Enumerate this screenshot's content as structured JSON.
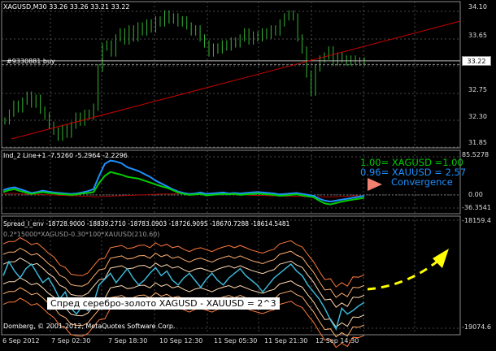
{
  "colors": {
    "background": "#000000",
    "grid": "#4a4a4a",
    "price_line": "#ffffff",
    "candles": "#35b535",
    "trendline": "#cc0000",
    "ind_green": "#00cc00",
    "ind_blue": "#1e90ff",
    "ind_red": "#aa0000",
    "spread_cyan": "#3ab6d8",
    "band_colors": [
      "#ffd9b0",
      "#ffb070",
      "#ff7a3c"
    ],
    "arrow_yellow": "#ffff00",
    "convergence_arrow": "#f08070"
  },
  "main_panel": {
    "header": "XAGUSD,M30  33.26 33.26 33.21 33.22",
    "order_label": "#9330881 buy",
    "current_price": "33.22",
    "y_ticks": [
      "34.10",
      "33.65",
      "33.22",
      "32.75",
      "32.30",
      "31.85"
    ]
  },
  "indicator_panel": {
    "header": "Ind_2 Line+1 -7.5260 -5.2964 -2.2296",
    "y_ticks": [
      "85.5278",
      "0.00",
      "-36.3541"
    ],
    "legend": [
      {
        "text": "1.00= XAGUSD =1.00",
        "color": "#00cc00"
      },
      {
        "text": "0.96= XAUUSD = 2.57",
        "color": "#1e90ff"
      },
      {
        "text": "Convergence",
        "color": "#1e90ff"
      }
    ]
  },
  "spread_panel": {
    "header": "Spread_I_env -18728.9000 -18839.2710 -18783.0903 -18726.9095 -18670.7288 -18614.5481",
    "formula": "0.2*15000*XAGUSD-0.30*100*XAUUSD(210.60)",
    "y_ticks": [
      "-18159.4",
      "-19074.6"
    ],
    "annotation": "Спред серебро-золото XAGUSD - XAUUSD = 2^3",
    "copyright": "Domberg, © 2001-2012, MetaQuotes Software Corp."
  },
  "time_axis": [
    "6 Sep 2012",
    "7 Sep 02:30",
    "7 Sep 18:30",
    "10 Sep 12:30",
    "11 Sep 05:30",
    "11 Sep 21:30",
    "12 Sep 14:30"
  ],
  "series": {
    "price": [
      32.22,
      32.35,
      32.5,
      32.42,
      32.55,
      32.65,
      32.5,
      32.6,
      32.4,
      32.3,
      32.15,
      32.05,
      31.95,
      32.1,
      32.0,
      32.15,
      32.3,
      32.2,
      32.35,
      32.3,
      32.45,
      33.1,
      33.45,
      33.5,
      33.35,
      33.6,
      33.7,
      33.55,
      33.75,
      33.6,
      33.8,
      33.7,
      33.85,
      33.75,
      33.9,
      33.85,
      34.0,
      33.9,
      33.95,
      33.85,
      33.9,
      33.8,
      33.7,
      33.75,
      33.6,
      33.5,
      33.35,
      33.45,
      33.4,
      33.5,
      33.45,
      33.55,
      33.5,
      33.6,
      33.7,
      33.55,
      33.65,
      33.6,
      33.7,
      33.65,
      33.75,
      33.7,
      33.85,
      33.95,
      34.0,
      33.95,
      33.6,
      33.4,
      33.0,
      32.7,
      33.1,
      33.25,
      33.3,
      33.4,
      33.2,
      33.3,
      33.25,
      33.2,
      33.25,
      33.22,
      33.2,
      33.22
    ],
    "ind_green": [
      6,
      10,
      12,
      8,
      5,
      2,
      4,
      6,
      4,
      3,
      2,
      1,
      0,
      1,
      3,
      4,
      6,
      25,
      40,
      48,
      45,
      42,
      38,
      36,
      34,
      30,
      26,
      22,
      18,
      15,
      10,
      5,
      2,
      0,
      1,
      2,
      -1,
      0,
      1,
      2,
      1,
      2,
      0,
      1,
      2,
      3,
      2,
      1,
      0,
      -2,
      -1,
      0,
      1,
      -1,
      -3,
      -5,
      -12,
      -18,
      -20,
      -17,
      -14,
      -12,
      -10,
      -8,
      -6
    ],
    "ind_blue": [
      10,
      14,
      16,
      12,
      8,
      4,
      6,
      9,
      7,
      5,
      4,
      3,
      2,
      3,
      5,
      8,
      12,
      40,
      65,
      72,
      70,
      66,
      58,
      54,
      50,
      44,
      38,
      30,
      24,
      18,
      12,
      7,
      4,
      2,
      3,
      5,
      2,
      3,
      4,
      5,
      3,
      4,
      3,
      4,
      5,
      6,
      5,
      4,
      3,
      1,
      2,
      3,
      4,
      2,
      0,
      -2,
      -8,
      -12,
      -14,
      -12,
      -10,
      -8,
      -6,
      -4,
      -2
    ],
    "ind_red": [
      2,
      3,
      3,
      2,
      2,
      1,
      1,
      1,
      0,
      0,
      -1,
      -1,
      -2,
      -2,
      -3,
      -3,
      -4,
      -4,
      -3,
      -3,
      -2,
      -2,
      -1,
      -1,
      0,
      0,
      1,
      1,
      2,
      2,
      2,
      3,
      3,
      3,
      3,
      3,
      2,
      2,
      2,
      1,
      1,
      1,
      0,
      0,
      -1,
      -1,
      -1,
      -2,
      -2,
      -2,
      -3,
      -3,
      -3,
      -3,
      -4,
      -4,
      -4,
      -4,
      -4,
      -4,
      -3,
      -3,
      -2,
      -2,
      -2
    ],
    "spread": [
      -18620,
      -18500,
      -18580,
      -18640,
      -18560,
      -18520,
      -18600,
      -18680,
      -18640,
      -18720,
      -18820,
      -18760,
      -18900,
      -18950,
      -18880,
      -18920,
      -18860,
      -18700,
      -18650,
      -18600,
      -18680,
      -18620,
      -18560,
      -18640,
      -18700,
      -18660,
      -18600,
      -18550,
      -18620,
      -18580,
      -18660,
      -18700,
      -18640,
      -18600,
      -18660,
      -18720,
      -18650,
      -18600,
      -18660,
      -18700,
      -18640,
      -18600,
      -18560,
      -18620,
      -18660,
      -18700,
      -18760,
      -18700,
      -18640,
      -18600,
      -18560,
      -18520,
      -18580,
      -18620,
      -18700,
      -18760,
      -18820,
      -18900,
      -19000,
      -19080,
      -18900,
      -18950,
      -18920,
      -18880,
      -18850
    ]
  }
}
